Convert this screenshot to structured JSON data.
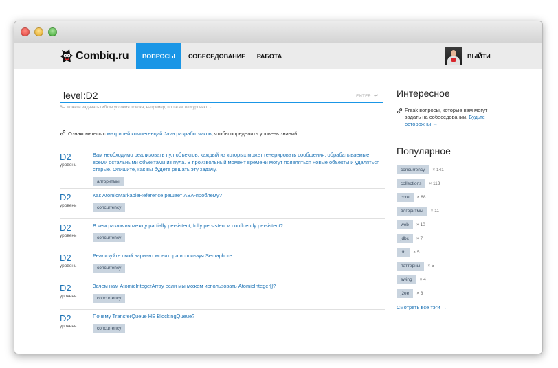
{
  "nav": {
    "logo": "Combiq.ru",
    "items": [
      "ВОПРОСЫ",
      "СОБЕСЕДОВАНИЕ",
      "РАБОТА"
    ],
    "logout": "ВЫЙТИ"
  },
  "search": {
    "value": "level:D2",
    "enter_hint": "ENTER",
    "enter_icon": "return-arrow-icon",
    "hint": "Вы можете задавать гибкие условия поиска, например, по тэгам или уровню →"
  },
  "info": {
    "before": "Ознакомьтесь с ",
    "link": "матрицей компетенций Java разработчиков",
    "after": ", чтобы определить уровень знаний."
  },
  "questions": [
    {
      "level": "D2",
      "level_label": "уровень",
      "text": "Вам необходимо реализовать пул объектов, каждый из которых может генерировать сообщения, обрабатываемые всеми остальными объектами из пула. В произвольный момент времени могут появляться новые объекты и удаляться старые. Опишите, как вы будете решать эту задачу.",
      "tag": "алгоритмы"
    },
    {
      "level": "D2",
      "level_label": "уровень",
      "text": "Как AtomicMarkableReference решает ABA-проблему?",
      "tag": "concurrency"
    },
    {
      "level": "D2",
      "level_label": "уровень",
      "text": "В чем различия между partially persistent, fully persistent и confluently persistent?",
      "tag": "concurrency"
    },
    {
      "level": "D2",
      "level_label": "уровень",
      "text": "Реализуйте свой вариант монитора используя Semaphore.",
      "tag": "concurrency"
    },
    {
      "level": "D2",
      "level_label": "уровень",
      "text": "Зачем нам AtomicIntegerArray если мы можем использовать AtomicInteger[]?",
      "tag": "concurrency"
    },
    {
      "level": "D2",
      "level_label": "уровень",
      "text": "Почему TransferQueue НЕ BlockingQueue?",
      "tag": "concurrency"
    }
  ],
  "sidebar": {
    "interesting_title": "Интересное",
    "interesting_text": "Freak вопросы, которые вам могут задать на собеседовании. ",
    "interesting_link": "Будьте осторожны →",
    "popular_title": "Популярное",
    "tags": [
      {
        "name": "concurrency",
        "count": "× 141"
      },
      {
        "name": "collections",
        "count": "× 113"
      },
      {
        "name": "core",
        "count": "× 88"
      },
      {
        "name": "алгоритмы",
        "count": "× 11"
      },
      {
        "name": "web",
        "count": "× 10"
      },
      {
        "name": "jdbc",
        "count": "× 7"
      },
      {
        "name": "db",
        "count": "× 5"
      },
      {
        "name": "паттерны",
        "count": "× 5"
      },
      {
        "name": "swing",
        "count": "× 4"
      },
      {
        "name": "j2ee",
        "count": "× 3"
      }
    ],
    "all_tags": "Смотреть все тэги →"
  },
  "colors": {
    "accent": "#1a96e6",
    "link": "#1d73b5",
    "tag_bg": "#c9d4df"
  }
}
